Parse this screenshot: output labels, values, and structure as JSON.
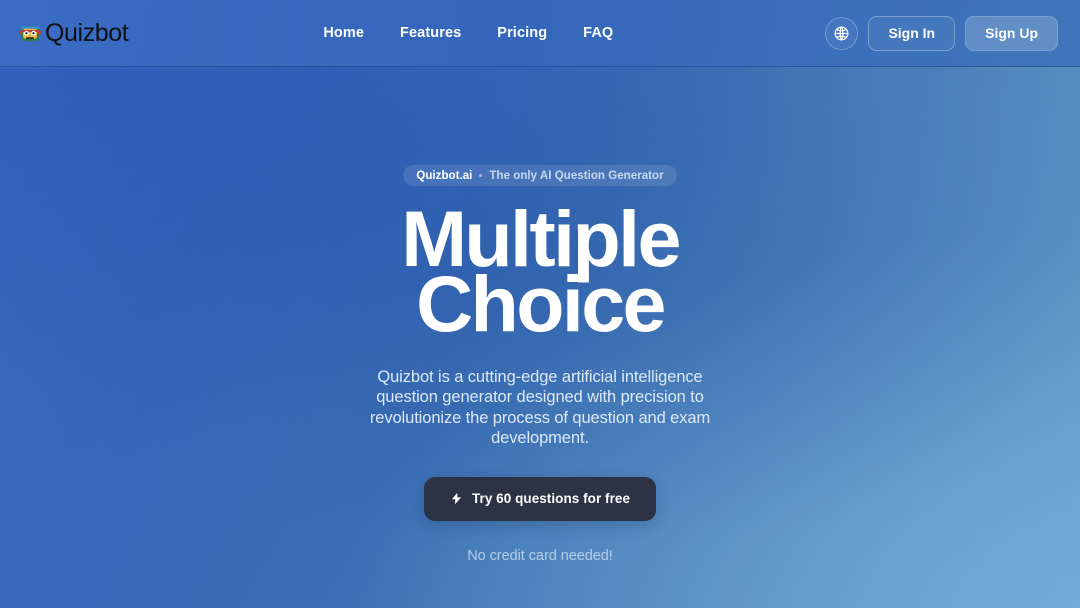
{
  "brand": {
    "name": "Quizbot",
    "logo_icon": "robot-face-icon"
  },
  "nav": {
    "items": [
      {
        "label": "Home"
      },
      {
        "label": "Features"
      },
      {
        "label": "Pricing"
      },
      {
        "label": "FAQ"
      }
    ]
  },
  "header_actions": {
    "language_icon": "globe-icon",
    "sign_in_label": "Sign In",
    "sign_up_label": "Sign Up"
  },
  "hero": {
    "badge": {
      "brand": "Quizbot.ai",
      "separator": "•",
      "tagline": "The only AI Question Generator"
    },
    "headline_line1": "Multiple",
    "headline_line2": "Choice",
    "subcopy": "Quizbot is a cutting-edge artificial intelligence question generator designed with precision to revolutionize the process of question and exam development.",
    "cta": {
      "icon": "lightning-bolt-icon",
      "label": "Try 60 questions for free"
    },
    "fineprint": "No credit card needed!"
  },
  "colors": {
    "background_top_left": "#3567bb",
    "background_bottom_right": "#63a0cd",
    "header": "#3b6cc4",
    "cta_background": "#2b3344",
    "text_on_blue": "#ffffff",
    "subcopy_text": "#dce9f7"
  }
}
